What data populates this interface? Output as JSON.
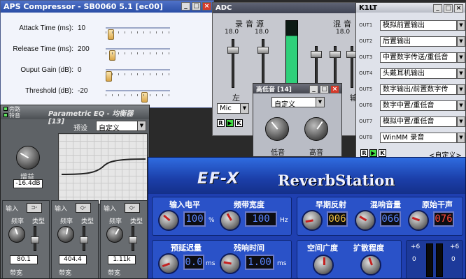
{
  "aps": {
    "title": "APS Compressor - SB0060 5.1 [ec00]",
    "rows": [
      {
        "label": "Attack Time (ms):",
        "value": "10",
        "level": 0.04
      },
      {
        "label": "Release Time (ms):",
        "value": "200",
        "level": 0.06
      },
      {
        "label": "Ouput Gain (dB):",
        "value": "0",
        "level": 0.0
      },
      {
        "label": "Threshold (dB):",
        "value": "-20",
        "level": 0.62
      }
    ]
  },
  "adc": {
    "title": "ADC",
    "left_group": "录音源",
    "right_group": "混音",
    "level_a": "18.0",
    "level_b": "18.0",
    "level_c": "18.0",
    "left_label": "左",
    "right_label": "输",
    "source": "Mic"
  },
  "tone": {
    "title": "高低音 [14]",
    "preset": "自定义",
    "bass_label": "低音",
    "treble_label": "高音"
  },
  "k1lt": {
    "title": "K1LT",
    "rows": [
      {
        "id": "OUT1",
        "value": "模拟前置输出"
      },
      {
        "id": "OUT2",
        "value": "后置输出"
      },
      {
        "id": "OUT3",
        "value": "中置数字传送/重低音"
      },
      {
        "id": "OUT4",
        "value": "头戴耳机输出"
      },
      {
        "id": "OUT5",
        "value": "数字输出/前置数字传"
      },
      {
        "id": "OUT6",
        "value": "数字中置/重低音"
      },
      {
        "id": "OUT7",
        "value": "模拟中置/重低音"
      },
      {
        "id": "OUT8",
        "value": "WinMM 录音"
      }
    ],
    "footer": "<自定义>"
  },
  "peq": {
    "title": "Parametric EQ - 均衡器 [13]",
    "bypass": "旁路",
    "phase": "铃音",
    "preset_label": "预设",
    "preset_value": "自定义",
    "gain_label": "增益",
    "gain_value": "-16.4dB",
    "band1": {
      "input": "输入",
      "freq": "频率",
      "type": "类型",
      "value": "80.1",
      "bw": "带宽"
    },
    "band2": {
      "input": "输入",
      "freq": "频率",
      "type": "类型",
      "value": "404.4",
      "bw": "带宽"
    },
    "band3": {
      "input": "输入",
      "freq": "频率",
      "type": "类型",
      "value": "1.11k",
      "bw": "带宽"
    }
  },
  "reverb": {
    "logo": "EF-X",
    "name": "ReverbStation",
    "input_level": "输入电平",
    "band_width": "频带宽度",
    "early": "早期反射",
    "mix": "混响音量",
    "dry": "原始干声",
    "lcd_input": "100",
    "lcd_band": "100",
    "lcd_early": "006",
    "lcd_mix": "066",
    "lcd_dry": "076",
    "unit_pct": "%",
    "unit_hz": "Hz",
    "pre_delay": "预延迟量",
    "decay": "残响时间",
    "space": "空间广度",
    "diffusion": "扩散程度",
    "lcd_pre": "0.0",
    "lcd_decay": "1.00",
    "unit_ms": "ms",
    "unit_ms2": "ms",
    "meter_a": "+6",
    "meter_b": "+6",
    "meter_c": "0",
    "meter_d": "0"
  }
}
